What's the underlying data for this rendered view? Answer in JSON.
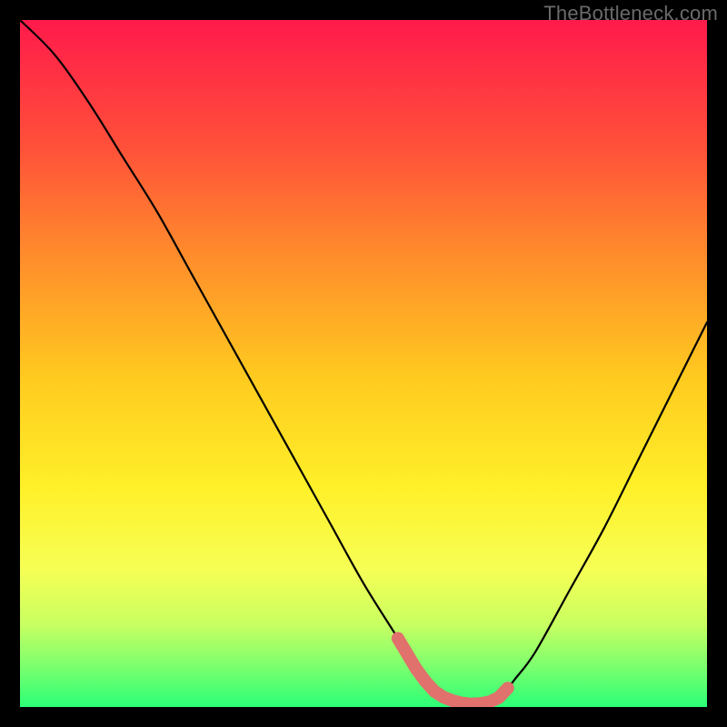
{
  "watermark": "TheBottleneck.com",
  "colors": {
    "page_bg": "#000000",
    "gradient_top": "#ff1a4b",
    "gradient_bottom": "#2bff77",
    "curve": "#000000",
    "marker": "#e0716c"
  },
  "chart_data": {
    "type": "line",
    "title": "",
    "xlabel": "",
    "ylabel": "",
    "xlim": [
      0,
      100
    ],
    "ylim": [
      0,
      100
    ],
    "series": [
      {
        "name": "bottleneck-curve",
        "x": [
          0,
          5,
          10,
          15,
          20,
          25,
          30,
          35,
          40,
          45,
          50,
          55,
          58,
          60,
          62,
          64,
          66,
          68,
          70,
          72,
          75,
          80,
          85,
          90,
          95,
          100
        ],
        "values": [
          100,
          95,
          88,
          80,
          72,
          63,
          54,
          45,
          36,
          27,
          18,
          10,
          5,
          2.5,
          1.2,
          0.6,
          0.4,
          0.6,
          1.5,
          4,
          8,
          17,
          26,
          36,
          46,
          56
        ]
      }
    ],
    "annotations": [
      {
        "name": "optimal-marker",
        "x_start": 55,
        "x_end": 71,
        "y": 1.2
      }
    ]
  }
}
